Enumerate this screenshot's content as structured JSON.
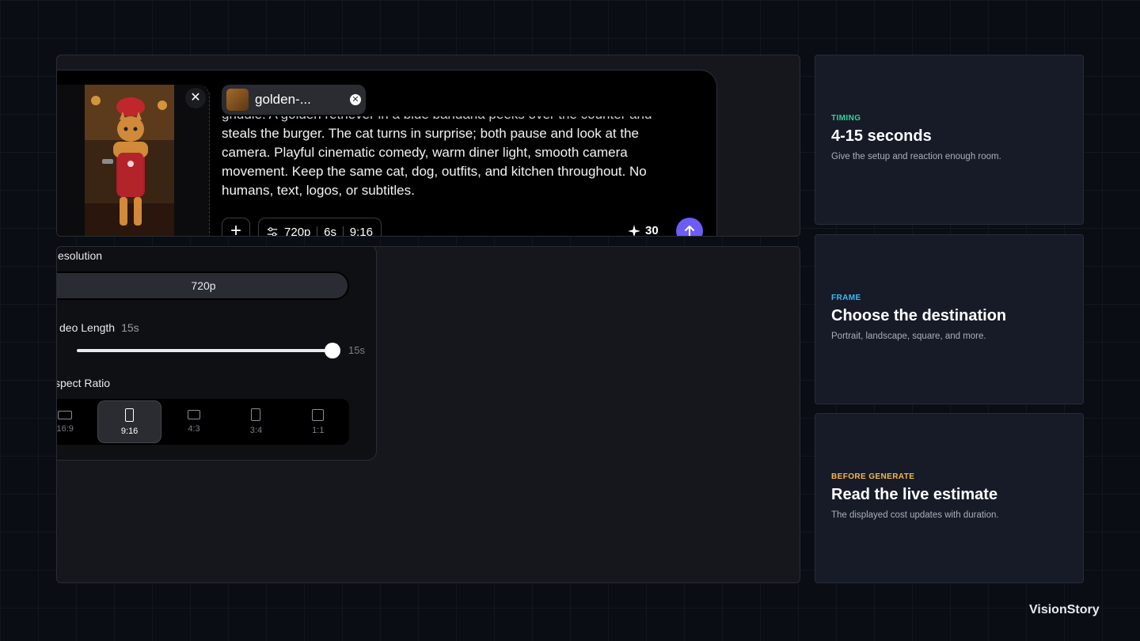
{
  "composer": {
    "attachment_name": "golden-...",
    "prompt_cut_line": "griddle. A golden retriever in a blue bandana peeks over the counter and",
    "prompt_lines": [
      "steals the burger. The cat turns in surprise; both pause and look at the",
      "camera. Playful cinematic comedy, warm diner light, smooth camera",
      "movement. Keep the same cat, dog, outfits, and kitchen throughout. No",
      "humans, text, logos, or subtitles."
    ],
    "settings_resolution": "720p",
    "settings_length": "6s",
    "settings_ratio": "9:16",
    "credits": "30"
  },
  "settings": {
    "resolution_label": "esolution",
    "resolution_value": "720p",
    "length_label": "deo Length",
    "length_value": "15s",
    "slider_min": "s",
    "slider_max": "15s",
    "slider_level": 1.0,
    "aspect_label": "spect Ratio",
    "ratios": [
      {
        "label": "16:9",
        "active": false
      },
      {
        "label": "9:16",
        "active": true
      },
      {
        "label": "4:3",
        "active": false
      },
      {
        "label": "3:4",
        "active": false
      },
      {
        "label": "1:1",
        "active": false
      }
    ]
  },
  "cards": [
    {
      "tag": "TIMING",
      "tag_color": "#34d399",
      "title": "4-15 seconds",
      "desc": "Give the setup and reaction enough room."
    },
    {
      "tag": "FRAME",
      "tag_color": "#38bdf8",
      "title": "Choose the destination",
      "desc": "Portrait, landscape, square, and more."
    },
    {
      "tag": "BEFORE GENERATE",
      "tag_color": "#f5b74a",
      "title": "Read the live estimate",
      "desc": "The displayed cost updates with duration."
    }
  ],
  "brand": "VisionStory"
}
